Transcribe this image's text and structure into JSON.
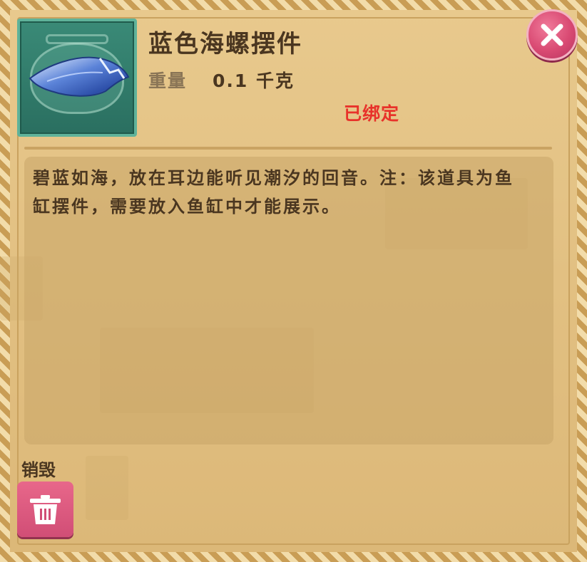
{
  "item": {
    "name": "蓝色海螺摆件",
    "weight_label": "重量",
    "weight_value": "0.1 千克",
    "bound_status": "已绑定",
    "icon": "blue-conch-in-fishbowl",
    "description": "碧蓝如海，放在耳边能听见潮汐的回音。注：该道具为鱼缸摆件，需要放入鱼缸中才能展示。"
  },
  "actions": {
    "destroy_label": "销毁",
    "destroy_icon": "trash-bin-icon",
    "close_icon": "close-icon"
  },
  "colors": {
    "bound_status": "#e8322a",
    "close_button": "#d94a73",
    "destroy_button": "#d14e76",
    "item_frame": "#2a6f60"
  }
}
